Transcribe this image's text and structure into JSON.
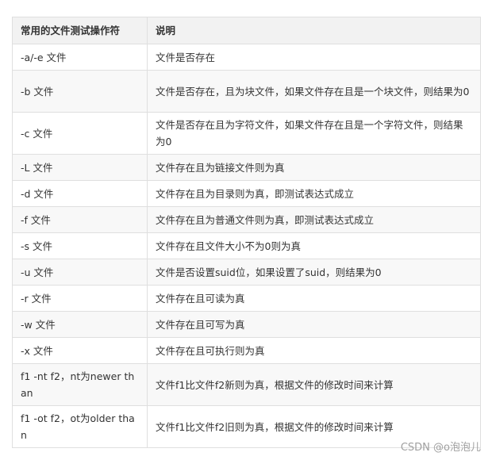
{
  "table": {
    "headers": [
      "常用的文件测试操作符",
      "说明"
    ],
    "rows": [
      {
        "op": "-a/-e 文件",
        "desc": "文件是否存在",
        "tall": false
      },
      {
        "op": "-b 文件",
        "desc": "文件是否存在，且为块文件，如果文件存在且是一个块文件，则结果为0",
        "tall": true
      },
      {
        "op": "-c 文件",
        "desc": "文件是否存在且为字符文件，如果文件存在且是一个字符文件，则结果为0",
        "tall": true
      },
      {
        "op": "-L 文件",
        "desc": "文件存在且为链接文件则为真",
        "tall": false
      },
      {
        "op": "-d 文件",
        "desc": "文件存在且为目录则为真，即测试表达式成立",
        "tall": false
      },
      {
        "op": "-f 文件",
        "desc": "文件存在且为普通文件则为真，即测试表达式成立",
        "tall": false
      },
      {
        "op": "-s 文件",
        "desc": "文件存在且文件大小不为0则为真",
        "tall": false
      },
      {
        "op": "-u 文件",
        "desc": "文件是否设置suid位，如果设置了suid，则结果为0",
        "tall": false
      },
      {
        "op": "-r 文件",
        "desc": "文件存在且可读为真",
        "tall": false
      },
      {
        "op": "-w 文件",
        "desc": "文件存在且可写为真",
        "tall": false
      },
      {
        "op": "-x 文件",
        "desc": "文件存在且可执行则为真",
        "tall": false
      },
      {
        "op": "f1 -nt f2，nt为newer than",
        "desc": "文件f1比文件f2新则为真，根据文件的修改时间来计算",
        "tall": true
      },
      {
        "op": "f1 -ot f2，ot为older than",
        "desc": "文件f1比文件f2旧则为真，根据文件的修改时间来计算",
        "tall": true
      }
    ]
  },
  "watermark": "CSDN @o泡泡儿"
}
